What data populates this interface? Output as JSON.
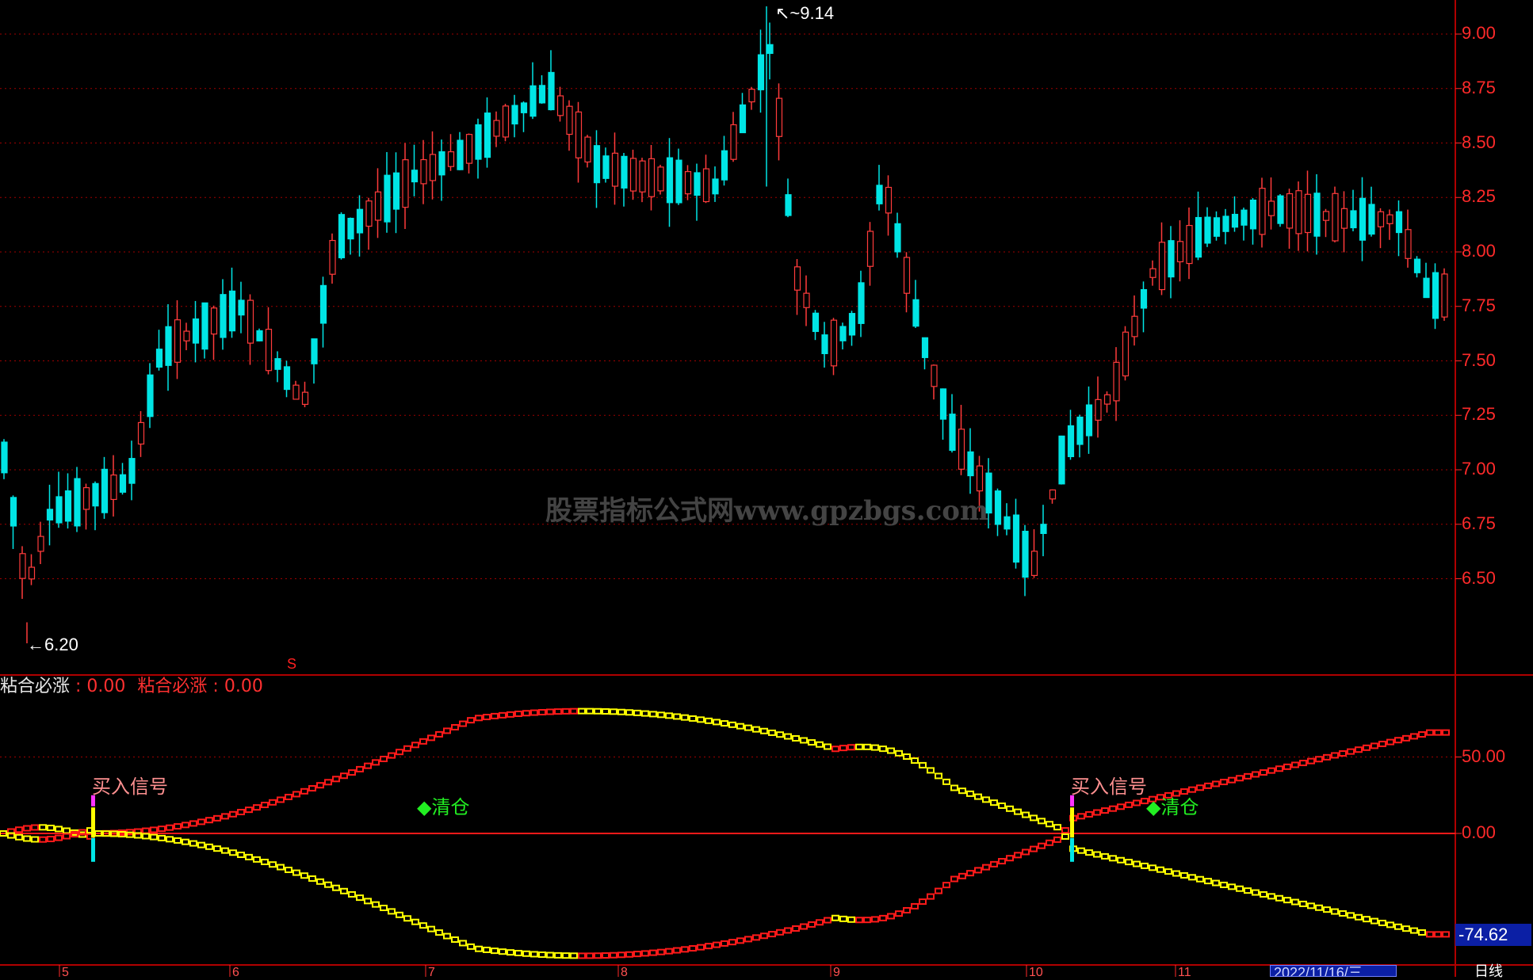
{
  "main_chart": {
    "price_axis": [
      "9.00",
      "8.75",
      "8.50",
      "8.25",
      "8.00",
      "7.75",
      "7.50",
      "7.25",
      "7.00",
      "6.75",
      "6.50"
    ],
    "high_label": "9.14",
    "low_label": "6.20",
    "watermark": "股票指标公式网www.gpzbgs.com",
    "marker": "S"
  },
  "indicator": {
    "name_key": "粘合必涨",
    "name_value": ": 0.00",
    "series_key": "粘合必涨",
    "series_value": ": 0.00",
    "axis": [
      "50.00",
      "0.00"
    ],
    "current_value": "-74.62",
    "buy_signal": "买入信号",
    "clear_signal": "◆清仓"
  },
  "x_axis": {
    "months": [
      "5",
      "6",
      "7",
      "8",
      "9",
      "10",
      "11"
    ],
    "current_date": "2022/11/16/三",
    "period": "日线"
  },
  "colors": {
    "up": "#ff3b3b",
    "down": "#00e5e5",
    "grid": "#a00000",
    "yellow": "#ffff00"
  },
  "chart_data": {
    "type": "candlestick",
    "price_range": [
      6.2,
      9.14
    ],
    "indicator_range": [
      -74.62,
      70
    ]
  }
}
